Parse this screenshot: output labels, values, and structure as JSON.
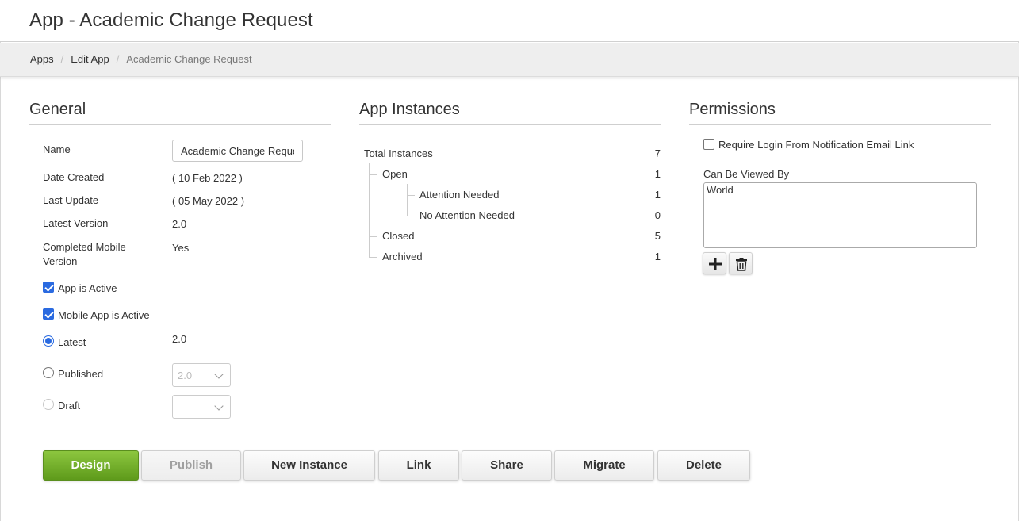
{
  "header": {
    "title": "App - Academic Change Request"
  },
  "breadcrumb": {
    "items": [
      "Apps",
      "Edit App",
      "Academic Change Request"
    ],
    "separator": "/"
  },
  "general": {
    "title": "General",
    "name_label": "Name",
    "name_value": "Academic Change Request",
    "date_created_label": "Date Created",
    "date_created_value": "( 10 Feb 2022 )",
    "last_update_label": "Last Update",
    "last_update_value": "( 05 May 2022 )",
    "latest_version_label": "Latest Version",
    "latest_version_value": "2.0",
    "completed_mobile_label_1": "Completed Mobile",
    "completed_mobile_label_2": "Version",
    "completed_mobile_value": "Yes",
    "app_active_label": "App is Active",
    "app_active_checked": true,
    "mobile_active_label": "Mobile App is Active",
    "mobile_active_checked": true,
    "latest_label": "Latest",
    "latest_value": "2.0",
    "published_label": "Published",
    "published_select_value": "2.0",
    "draft_label": "Draft",
    "draft_select_value": ""
  },
  "instances": {
    "title": "App Instances",
    "rows": [
      {
        "label": "Total Instances",
        "count": "7"
      },
      {
        "label": "Open",
        "count": "1"
      },
      {
        "label": "Attention Needed",
        "count": "1"
      },
      {
        "label": "No Attention Needed",
        "count": "0"
      },
      {
        "label": "Closed",
        "count": "5"
      },
      {
        "label": "Archived",
        "count": "1"
      }
    ]
  },
  "permissions": {
    "title": "Permissions",
    "require_login_label": "Require Login From Notification Email Link",
    "require_login_checked": false,
    "viewed_by_label": "Can Be Viewed By",
    "viewed_by_options": [
      "World"
    ],
    "add_icon": "plus-icon",
    "delete_icon": "trash-icon"
  },
  "actions": {
    "design": "Design",
    "publish": "Publish",
    "new_instance": "New Instance",
    "link": "Link",
    "share": "Share",
    "migrate": "Migrate",
    "delete": "Delete"
  },
  "colors": {
    "primary_button": "#6fab25",
    "accent": "#2a6ae0"
  }
}
